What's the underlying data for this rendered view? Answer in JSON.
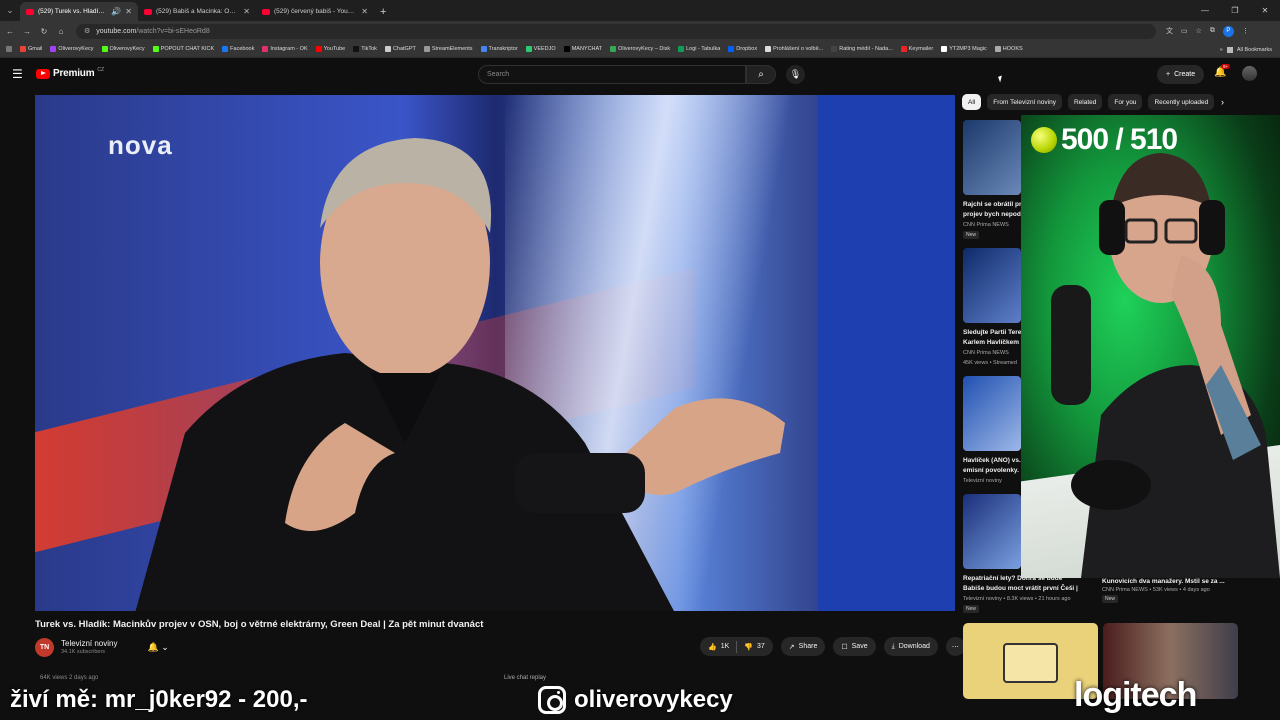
{
  "browser": {
    "tabs": [
      {
        "title": "(529) Turek vs. Hladík: Mac",
        "active": true
      },
      {
        "title": "(529) Babiš a Macinka: Opatřen",
        "active": false
      },
      {
        "title": "(529) červený babiš - YouTube",
        "active": false
      }
    ],
    "url": "youtube.com",
    "url_rest": "/watch?v=bi-sEHeoRd8",
    "bookmarks": [
      "Gmail",
      "OliverovyKecy",
      "OliverovyKecy",
      "POPOUT CHAT KICK",
      "Facebook",
      "Instagram - OK",
      "YouTube",
      "TikTok",
      "ChatGPT",
      "StreamElements",
      "Transkriptor",
      "VEEDJO",
      "MANYCHAT",
      "OliverovyKecy – Disk",
      "Logi - Tabulka",
      "Dropbox",
      "Prohlášení o volbě...",
      "Rating médií - Nada...",
      "Keymailer",
      "YT2MP3 Magic",
      "HOOKS"
    ],
    "all_bookmarks": "All Bookmarks",
    "profile_letter": "P"
  },
  "youtube": {
    "logo_text": "Premium",
    "logo_sup": "CZ",
    "search_placeholder": "Search",
    "create_label": "Create",
    "notif_badge": "9+"
  },
  "video": {
    "channel_watermark": "nova",
    "title": "Turek vs. Hladík: Macinkův projev v OSN, boj o větrné elektrárny, Green Deal | Za pět minut dvanáct",
    "channel_name": "Televizní noviny",
    "channel_initials": "TN",
    "subscribers": "34.1K subscribers",
    "likes": "1K",
    "dislikes": "37",
    "share": "Share",
    "save": "Save",
    "download": "Download",
    "views_date": "64K views  2 days ago",
    "live_chat": "Live chat replay"
  },
  "sidebar": {
    "chips": [
      "All",
      "From Televizní noviny",
      "Related",
      "For you",
      "Recently uploaded"
    ],
    "recommendations": [
      {
        "title_l1": "Rajchl se obrátil pr",
        "title_l2": "projev bych nepodc",
        "channel": "CNN Prima NEWS",
        "meta": "",
        "badge": "New"
      },
      {
        "title_l1": "Sledujte Partii Tere",
        "title_l2": "Karlem Havlíčkem",
        "channel": "CNN Prima NEWS",
        "meta": "45K views • Streamed",
        "badge": ""
      },
      {
        "title_l1": "Havlíček (ANO) vs. Víček",
        "title_l2": "emisní povolenky.",
        "channel": "Televizní noviny",
        "meta": "• 24K",
        "badge": ""
      },
      {
        "title_l1": "Repatriační lety? Dohra se bude",
        "title_l2": "Babiše budou moct vrátit první Češi |",
        "channel": "Televizní noviny",
        "meta": "• 8.3K views • 21 hours ago",
        "badge": "New"
      }
    ],
    "right_rec": {
      "title_l1": "Kunovicích dva manažery. Mstil se za ...",
      "channel": "CNN Prima NEWS",
      "meta": "• 53K views • 4 days ago",
      "badge": "New"
    }
  },
  "overlay": {
    "score": "500 / 510",
    "bottom_left": "živí mě: mr_j0ker92 - 200,-",
    "instagram": "oliverovykecy",
    "brand": "logitech"
  }
}
